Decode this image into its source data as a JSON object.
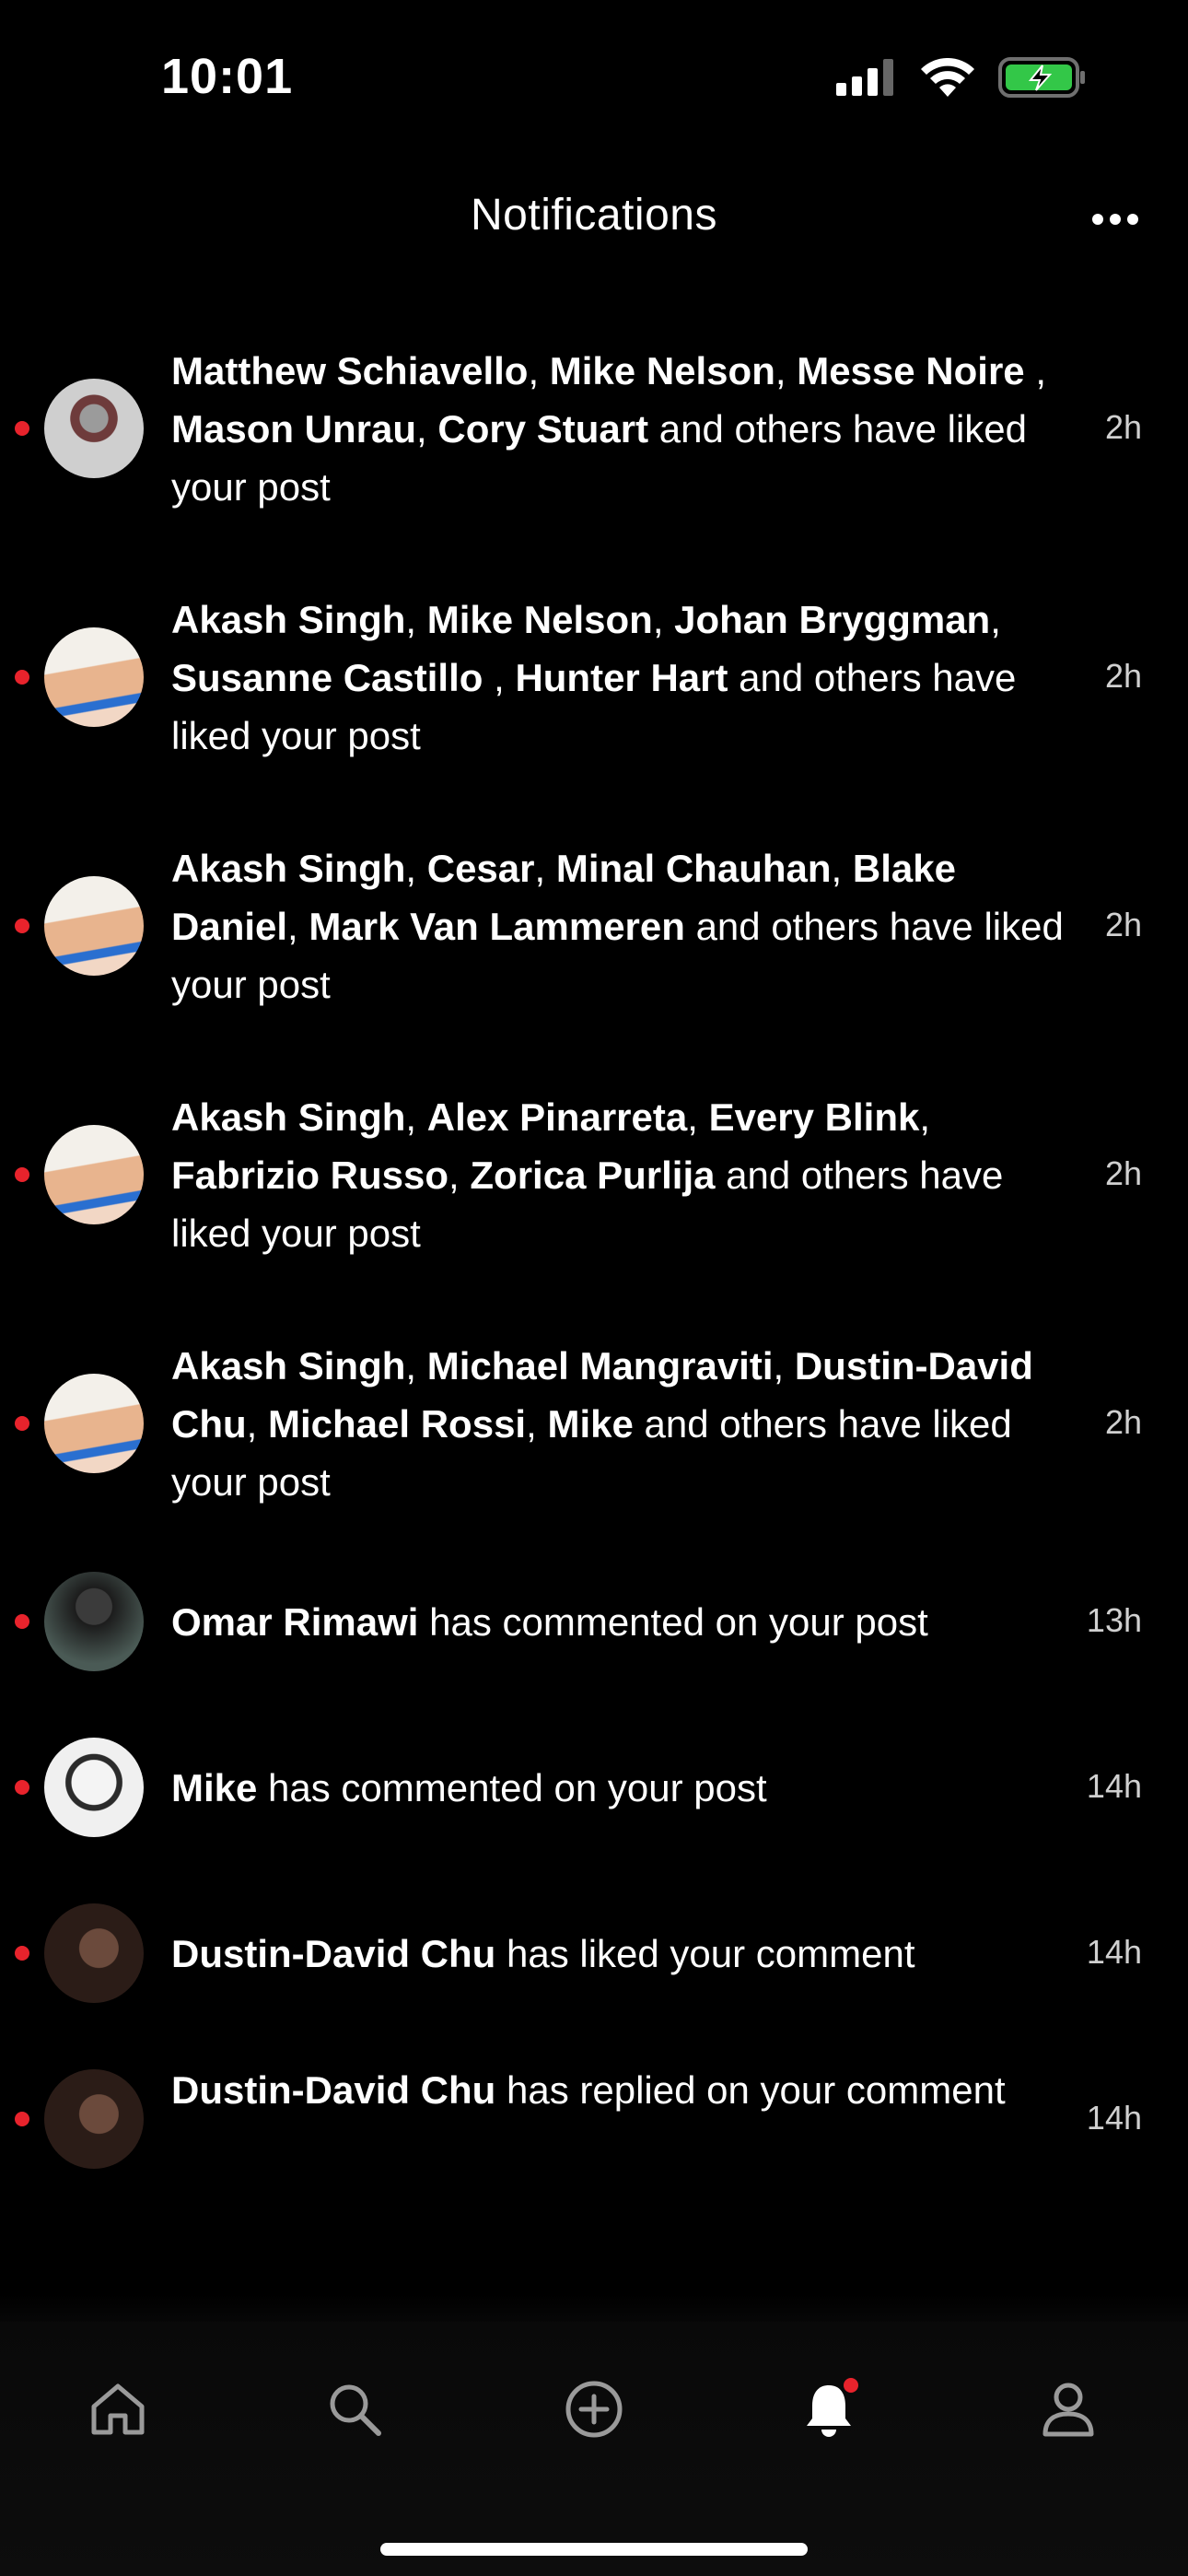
{
  "status_bar": {
    "time": "10:01"
  },
  "header": {
    "title": "Notifications"
  },
  "notifications": [
    {
      "parts": [
        [
          "Matthew Schiavello",
          1
        ],
        [
          ", ",
          0
        ],
        [
          "Mike Nelson",
          1
        ],
        [
          ", ",
          0
        ],
        [
          "Messe Noire",
          1
        ],
        [
          " , ",
          0
        ],
        [
          "Mason Unrau",
          1
        ],
        [
          ", ",
          0
        ],
        [
          "Cory Stuart",
          1
        ],
        [
          " and others have liked your post",
          0
        ]
      ],
      "time": "2h"
    },
    {
      "parts": [
        [
          "Akash Singh",
          1
        ],
        [
          ", ",
          0
        ],
        [
          "Mike Nelson",
          1
        ],
        [
          ", ",
          0
        ],
        [
          "Johan Bryggman",
          1
        ],
        [
          ", ",
          0
        ],
        [
          "Susanne Castillo",
          1
        ],
        [
          " , ",
          0
        ],
        [
          "Hunter Hart",
          1
        ],
        [
          " and others have liked your post",
          0
        ]
      ],
      "time": "2h"
    },
    {
      "parts": [
        [
          "Akash Singh",
          1
        ],
        [
          ", ",
          0
        ],
        [
          "Cesar",
          1
        ],
        [
          ", ",
          0
        ],
        [
          "Minal Chauhan",
          1
        ],
        [
          ", ",
          0
        ],
        [
          "Blake Daniel",
          1
        ],
        [
          ", ",
          0
        ],
        [
          "Mark Van Lammeren",
          1
        ],
        [
          " and others have liked your post",
          0
        ]
      ],
      "time": "2h"
    },
    {
      "parts": [
        [
          "Akash Singh",
          1
        ],
        [
          ", ",
          0
        ],
        [
          "Alex Pinarreta",
          1
        ],
        [
          ", ",
          0
        ],
        [
          "Every Blink",
          1
        ],
        [
          ", ",
          0
        ],
        [
          "Fabrizio Russo",
          1
        ],
        [
          ", ",
          0
        ],
        [
          "Zorica Purlija",
          1
        ],
        [
          "  and others have liked your post",
          0
        ]
      ],
      "time": "2h"
    },
    {
      "parts": [
        [
          "Akash Singh",
          1
        ],
        [
          ", ",
          0
        ],
        [
          "Michael Mangraviti",
          1
        ],
        [
          ", ",
          0
        ],
        [
          "Dustin-David Chu",
          1
        ],
        [
          ", ",
          0
        ],
        [
          "Michael Rossi",
          1
        ],
        [
          ", ",
          0
        ],
        [
          "Mike",
          1
        ],
        [
          " and others have liked your post",
          0
        ]
      ],
      "time": "2h"
    },
    {
      "parts": [
        [
          "Omar Rimawi",
          1
        ],
        [
          " has commented on your post",
          0
        ]
      ],
      "time": "13h"
    },
    {
      "parts": [
        [
          "Mike",
          1
        ],
        [
          " has commented on your post",
          0
        ]
      ],
      "time": "14h"
    },
    {
      "parts": [
        [
          "Dustin-David Chu",
          1
        ],
        [
          " has liked your comment",
          0
        ]
      ],
      "time": "14h"
    },
    {
      "parts": [
        [
          "Dustin-David Chu",
          1
        ],
        [
          " has replied on your comment",
          0
        ]
      ],
      "time": "14h"
    }
  ],
  "tabs": [
    {
      "icon": "home-icon"
    },
    {
      "icon": "search-icon"
    },
    {
      "icon": "add-icon"
    },
    {
      "icon": "bell-icon",
      "badge": true
    },
    {
      "icon": "profile-icon"
    }
  ],
  "colors": {
    "unread": "#e8232c",
    "background": "#000000"
  }
}
